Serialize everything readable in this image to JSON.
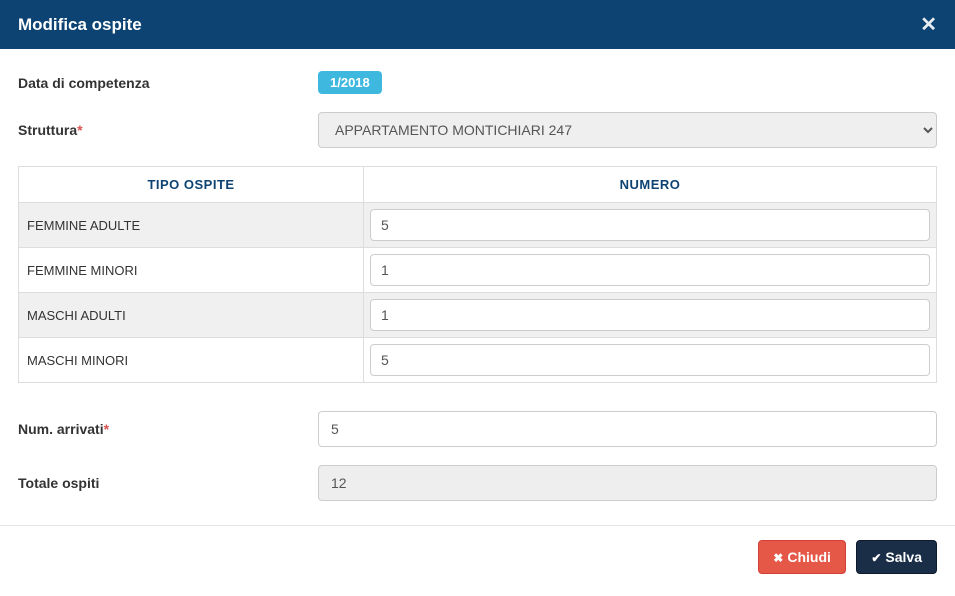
{
  "header": {
    "title": "Modifica ospite"
  },
  "form": {
    "date_label": "Data di competenza",
    "date_value": "1/2018",
    "structure_label": "Struttura",
    "structure_value": "APPARTAMENTO MONTICHIARI 247",
    "arrivals_label": "Num. arrivati",
    "arrivals_value": "5",
    "total_label": "Totale ospiti",
    "total_value": "12"
  },
  "table": {
    "header_type": "TIPO OSPITE",
    "header_number": "NUMERO",
    "rows": [
      {
        "type": "FEMMINE ADULTE",
        "number": "5"
      },
      {
        "type": "FEMMINE MINORI",
        "number": "1"
      },
      {
        "type": "MASCHI ADULTI",
        "number": "1"
      },
      {
        "type": "MASCHI MINORI",
        "number": "5"
      }
    ]
  },
  "footer": {
    "close_label": "Chiudi",
    "save_label": "Salva"
  }
}
